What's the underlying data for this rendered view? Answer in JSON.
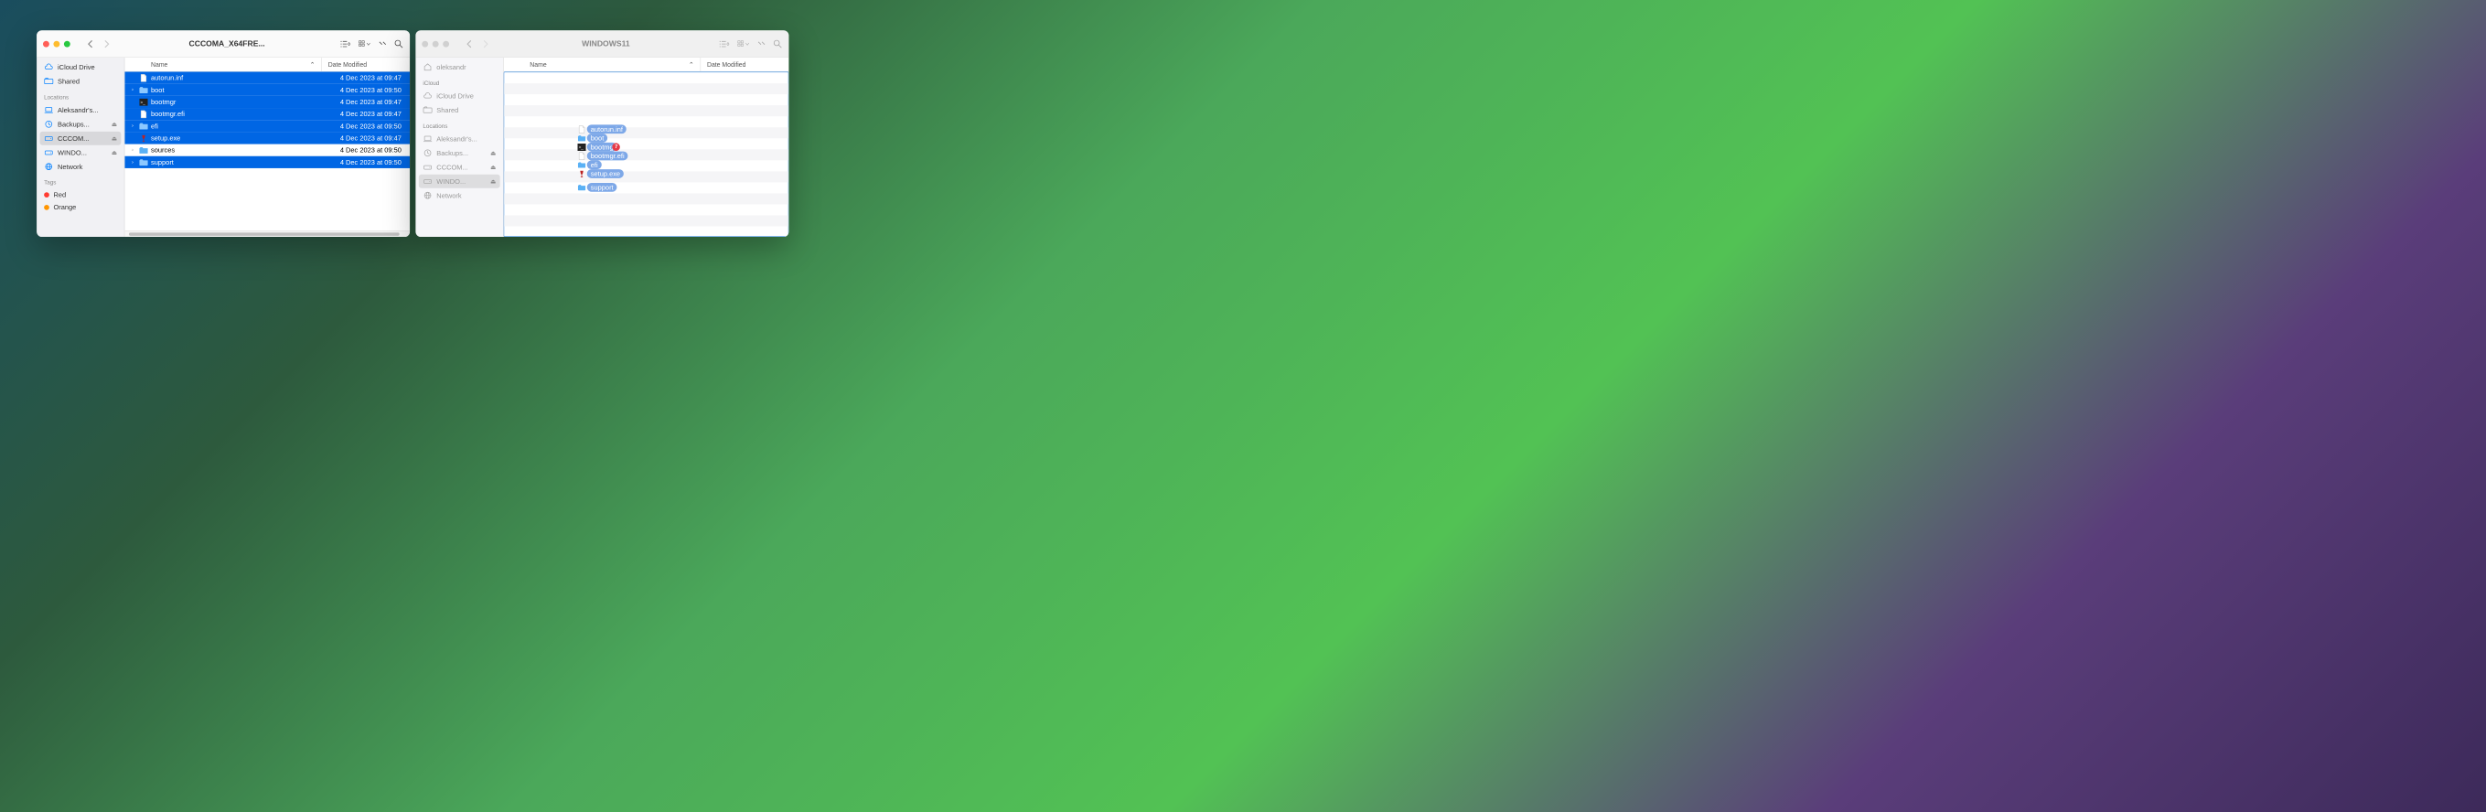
{
  "windows": [
    {
      "id": "left",
      "active": true,
      "title": "CCCOMA_X64FRE...",
      "sidebar": {
        "top_items": [
          {
            "icon": "cloud",
            "label": "iCloud Drive"
          },
          {
            "icon": "folder-shared",
            "label": "Shared"
          }
        ],
        "locations_label": "Locations",
        "locations": [
          {
            "icon": "laptop",
            "label": "Aleksandr's...",
            "eject": false
          },
          {
            "icon": "clock",
            "label": "Backups...",
            "eject": true
          },
          {
            "icon": "disk",
            "label": "CCCOM...",
            "eject": true,
            "selected": true
          },
          {
            "icon": "disk",
            "label": "WINDO...",
            "eject": true
          },
          {
            "icon": "globe",
            "label": "Network",
            "eject": false
          }
        ],
        "tags_label": "Tags",
        "tags": [
          {
            "color": "red",
            "label": "Red"
          },
          {
            "color": "orange",
            "label": "Orange"
          }
        ]
      },
      "columns": {
        "name": "Name",
        "date": "Date Modified"
      },
      "files": [
        {
          "kind": "file-text",
          "name": "autorun.inf",
          "date": "4 Dec 2023 at 09:47",
          "selected": true,
          "expandable": false
        },
        {
          "kind": "folder",
          "name": "boot",
          "date": "4 Dec 2023 at 09:50",
          "selected": true,
          "expandable": true
        },
        {
          "kind": "app-dos",
          "name": "bootmgr",
          "date": "4 Dec 2023 at 09:47",
          "selected": true,
          "expandable": false
        },
        {
          "kind": "file-text",
          "name": "bootmgr.efi",
          "date": "4 Dec 2023 at 09:47",
          "selected": true,
          "expandable": false
        },
        {
          "kind": "folder",
          "name": "efi",
          "date": "4 Dec 2023 at 09:50",
          "selected": true,
          "expandable": true
        },
        {
          "kind": "app-wine",
          "name": "setup.exe",
          "date": "4 Dec 2023 at 09:47",
          "selected": true,
          "expandable": false
        },
        {
          "kind": "folder",
          "name": "sources",
          "date": "4 Dec 2023 at 09:50",
          "selected": false,
          "expandable": true
        },
        {
          "kind": "folder",
          "name": "support",
          "date": "4 Dec 2023 at 09:50",
          "selected": true,
          "expandable": true
        }
      ]
    },
    {
      "id": "right",
      "active": false,
      "title": "WINDOWS11",
      "sidebar": {
        "top_items": [
          {
            "icon": "home",
            "label": "oleksandr"
          }
        ],
        "icloud_label": "iCloud",
        "icloud_items": [
          {
            "icon": "cloud",
            "label": "iCloud Drive"
          },
          {
            "icon": "folder-shared",
            "label": "Shared"
          }
        ],
        "locations_label": "Locations",
        "locations": [
          {
            "icon": "laptop",
            "label": "Aleksandr's...",
            "eject": false
          },
          {
            "icon": "clock",
            "label": "Backups...",
            "eject": true
          },
          {
            "icon": "disk",
            "label": "CCCOM...",
            "eject": true
          },
          {
            "icon": "disk",
            "label": "WINDO...",
            "eject": true,
            "selected": true
          },
          {
            "icon": "globe",
            "label": "Network",
            "eject": false
          }
        ]
      },
      "columns": {
        "name": "Name",
        "date": "Date Modified"
      },
      "drop_items": [
        {
          "kind": "file-text",
          "label": "autorun.inf"
        },
        {
          "kind": "folder",
          "label": "boot"
        },
        {
          "kind": "app-dos",
          "label": "bootmg",
          "badge": "7"
        },
        {
          "kind": "file-text",
          "label": "bootmgr.efi"
        },
        {
          "kind": "folder",
          "label": "efi"
        },
        {
          "kind": "app-wine",
          "label": "setup.exe"
        },
        {
          "kind": "folder",
          "label": "support",
          "gap": true
        }
      ]
    }
  ]
}
